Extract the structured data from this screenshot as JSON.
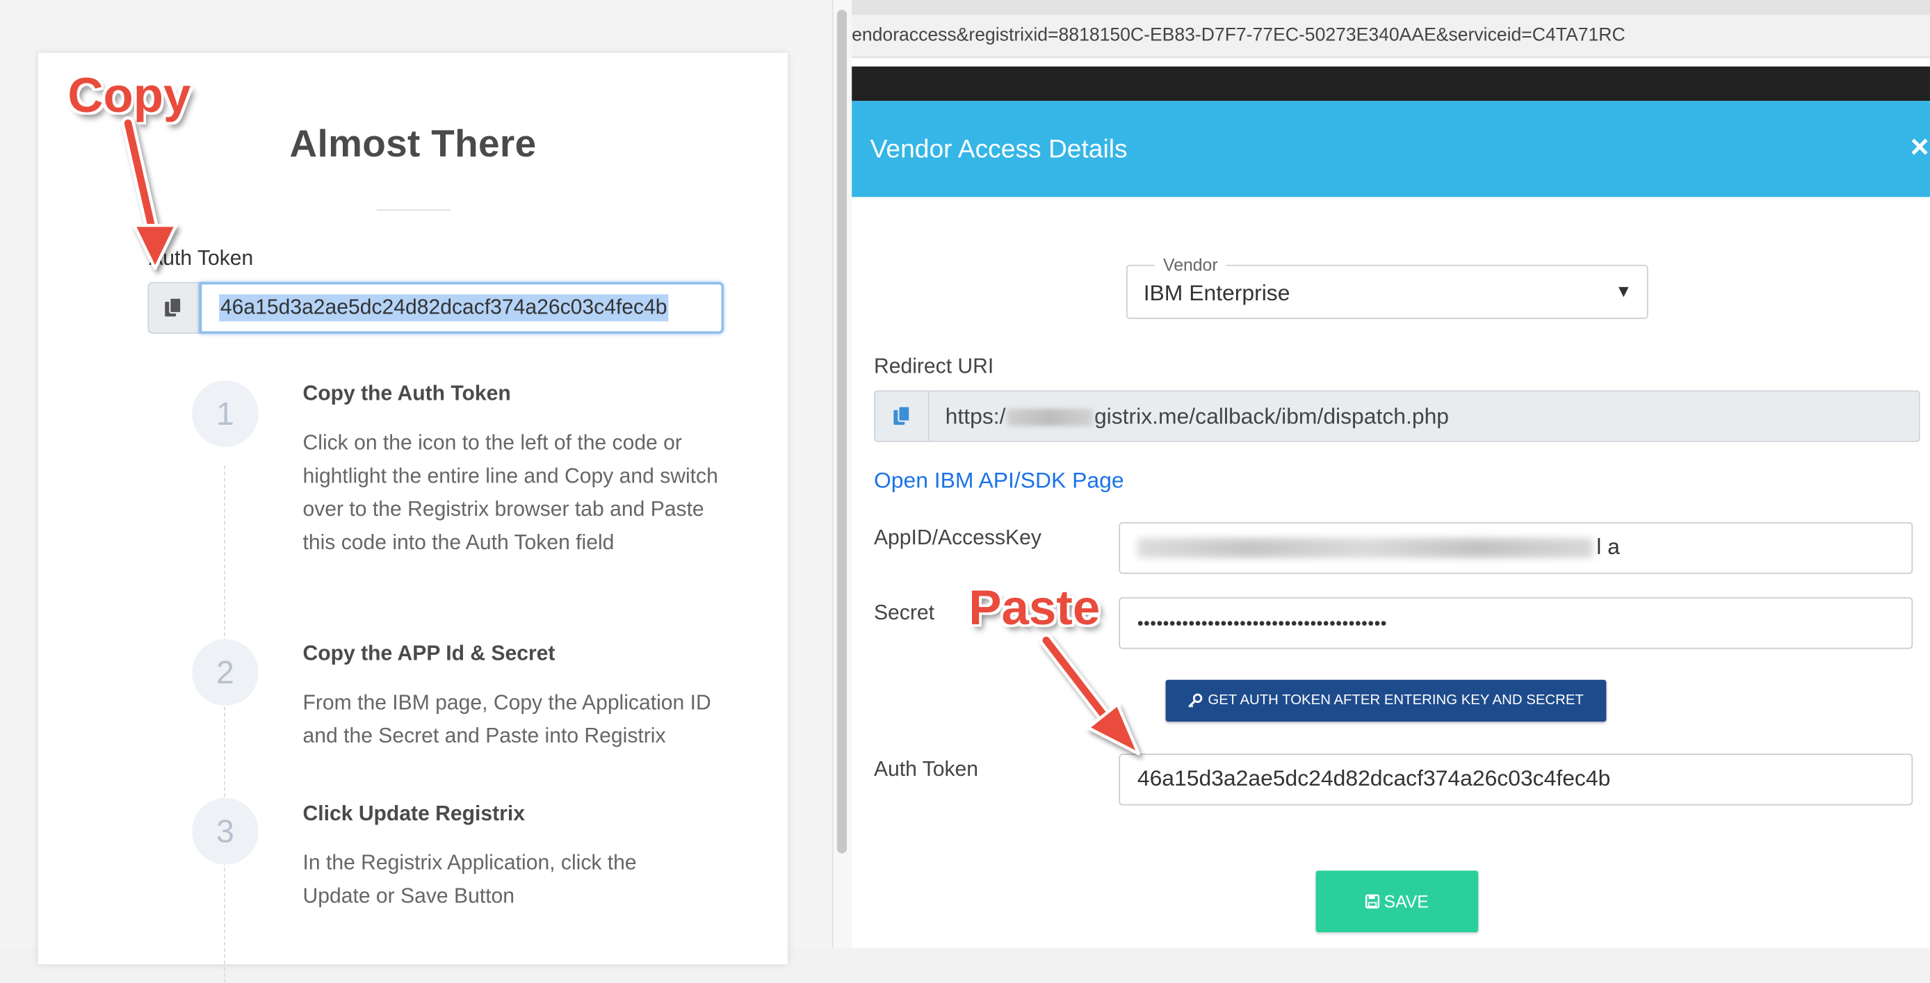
{
  "left": {
    "title": "Almost There",
    "auth_label": "Auth Token",
    "token_value": "46a15d3a2ae5dc24d82dcacf374a26c03c4fec4b",
    "steps": [
      {
        "num": "1",
        "title": "Copy the Auth Token",
        "body": "Click on the icon to the left of the code or hightlight the entire line and Copy and switch over to the Registrix browser tab and Paste this code into the Auth Token field"
      },
      {
        "num": "2",
        "title": "Copy the APP Id & Secret",
        "body": "From the IBM page, Copy the Application ID and the Secret and Paste into Registrix"
      },
      {
        "num": "3",
        "title": "Click Update Registrix",
        "body": "In the Registrix Application, click the Update or Save Button"
      }
    ]
  },
  "right": {
    "url": "endoraccess&registrixid=8818150C-EB83-D7F7-77EC-50273E340AAE&serviceid=C4TA71RC",
    "modal_title": "Vendor Access Details",
    "close_symbol": "×",
    "vendor_legend": "Vendor",
    "vendor_value": "IBM Enterprise",
    "redirect_label": "Redirect URI",
    "redirect_prefix": "https:/",
    "redirect_suffix": "gistrix.me/callback/ibm/dispatch.php",
    "open_link": "Open IBM API/SDK Page",
    "appid_label": "AppID/AccessKey",
    "appid_visible_tail": "l a",
    "secret_label": "Secret",
    "secret_value": "•••••••••••••••••••••••••••••••••••••••",
    "get_token_button": "GET AUTH TOKEN AFTER ENTERING KEY AND SECRET",
    "auth_label": "Auth Token",
    "auth_value": "46a15d3a2ae5dc24d82dcacf374a26c03c4fec4b",
    "save_button": "SAVE"
  },
  "annotations": {
    "copy": "Copy",
    "paste": "Paste",
    "color": "#e94b3c"
  },
  "colors": {
    "modal_header": "#36b6e6",
    "get_token_button": "#1e4b8c",
    "save_button": "#2bcf9c",
    "link": "#1a73e8"
  }
}
